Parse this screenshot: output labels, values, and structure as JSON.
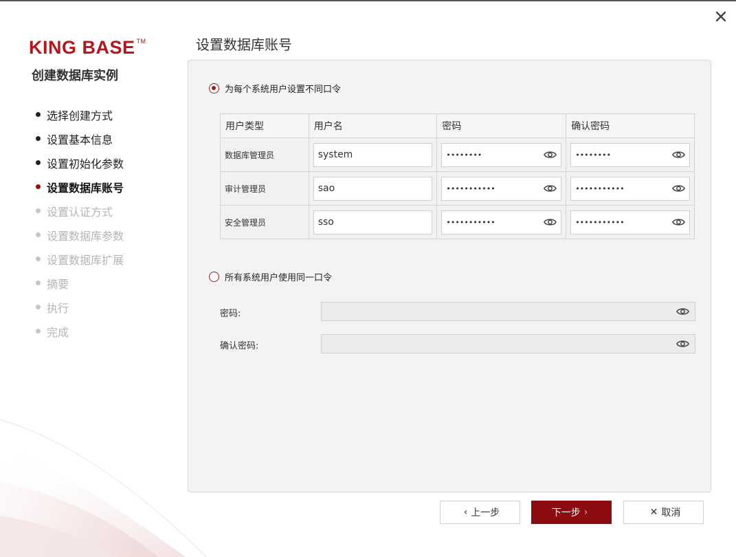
{
  "brand": {
    "logo_text": "KING BASE",
    "trademark": "TM"
  },
  "wizard": {
    "title": "创建数据库实例"
  },
  "steps": [
    {
      "label": "选择创建方式",
      "state": "done"
    },
    {
      "label": "设置基本信息",
      "state": "done"
    },
    {
      "label": "设置初始化参数",
      "state": "done"
    },
    {
      "label": "设置数据库账号",
      "state": "active"
    },
    {
      "label": "设置认证方式",
      "state": "pending"
    },
    {
      "label": "设置数据库参数",
      "state": "pending"
    },
    {
      "label": "设置数据库扩展",
      "state": "pending"
    },
    {
      "label": "摘要",
      "state": "pending"
    },
    {
      "label": "执行",
      "state": "pending"
    },
    {
      "label": "完成",
      "state": "pending"
    }
  ],
  "page": {
    "title": "设置数据库账号"
  },
  "options": {
    "per_user": {
      "label": "为每个系统用户设置不同口令",
      "selected": true
    },
    "shared": {
      "label": "所有系统用户使用同一口令",
      "selected": false
    }
  },
  "table": {
    "headers": [
      "用户类型",
      "用户名",
      "密码",
      "确认密码"
    ],
    "rows": [
      {
        "type": "数据库管理员",
        "username": "system",
        "password": "••••••••",
        "confirm": "••••••••"
      },
      {
        "type": "审计管理员",
        "username": "sao",
        "password": "•••••••••••",
        "confirm": "•••••••••••"
      },
      {
        "type": "安全管理员",
        "username": "sso",
        "password": "•••••••••••",
        "confirm": "•••••••••••"
      }
    ]
  },
  "shared_form": {
    "password_label": "密码:",
    "confirm_label": "确认密码:"
  },
  "buttons": {
    "prev": "上一步",
    "next": "下一步",
    "cancel": "取消"
  },
  "colors": {
    "accent": "#8b0d12",
    "brand": "#b3161c"
  }
}
